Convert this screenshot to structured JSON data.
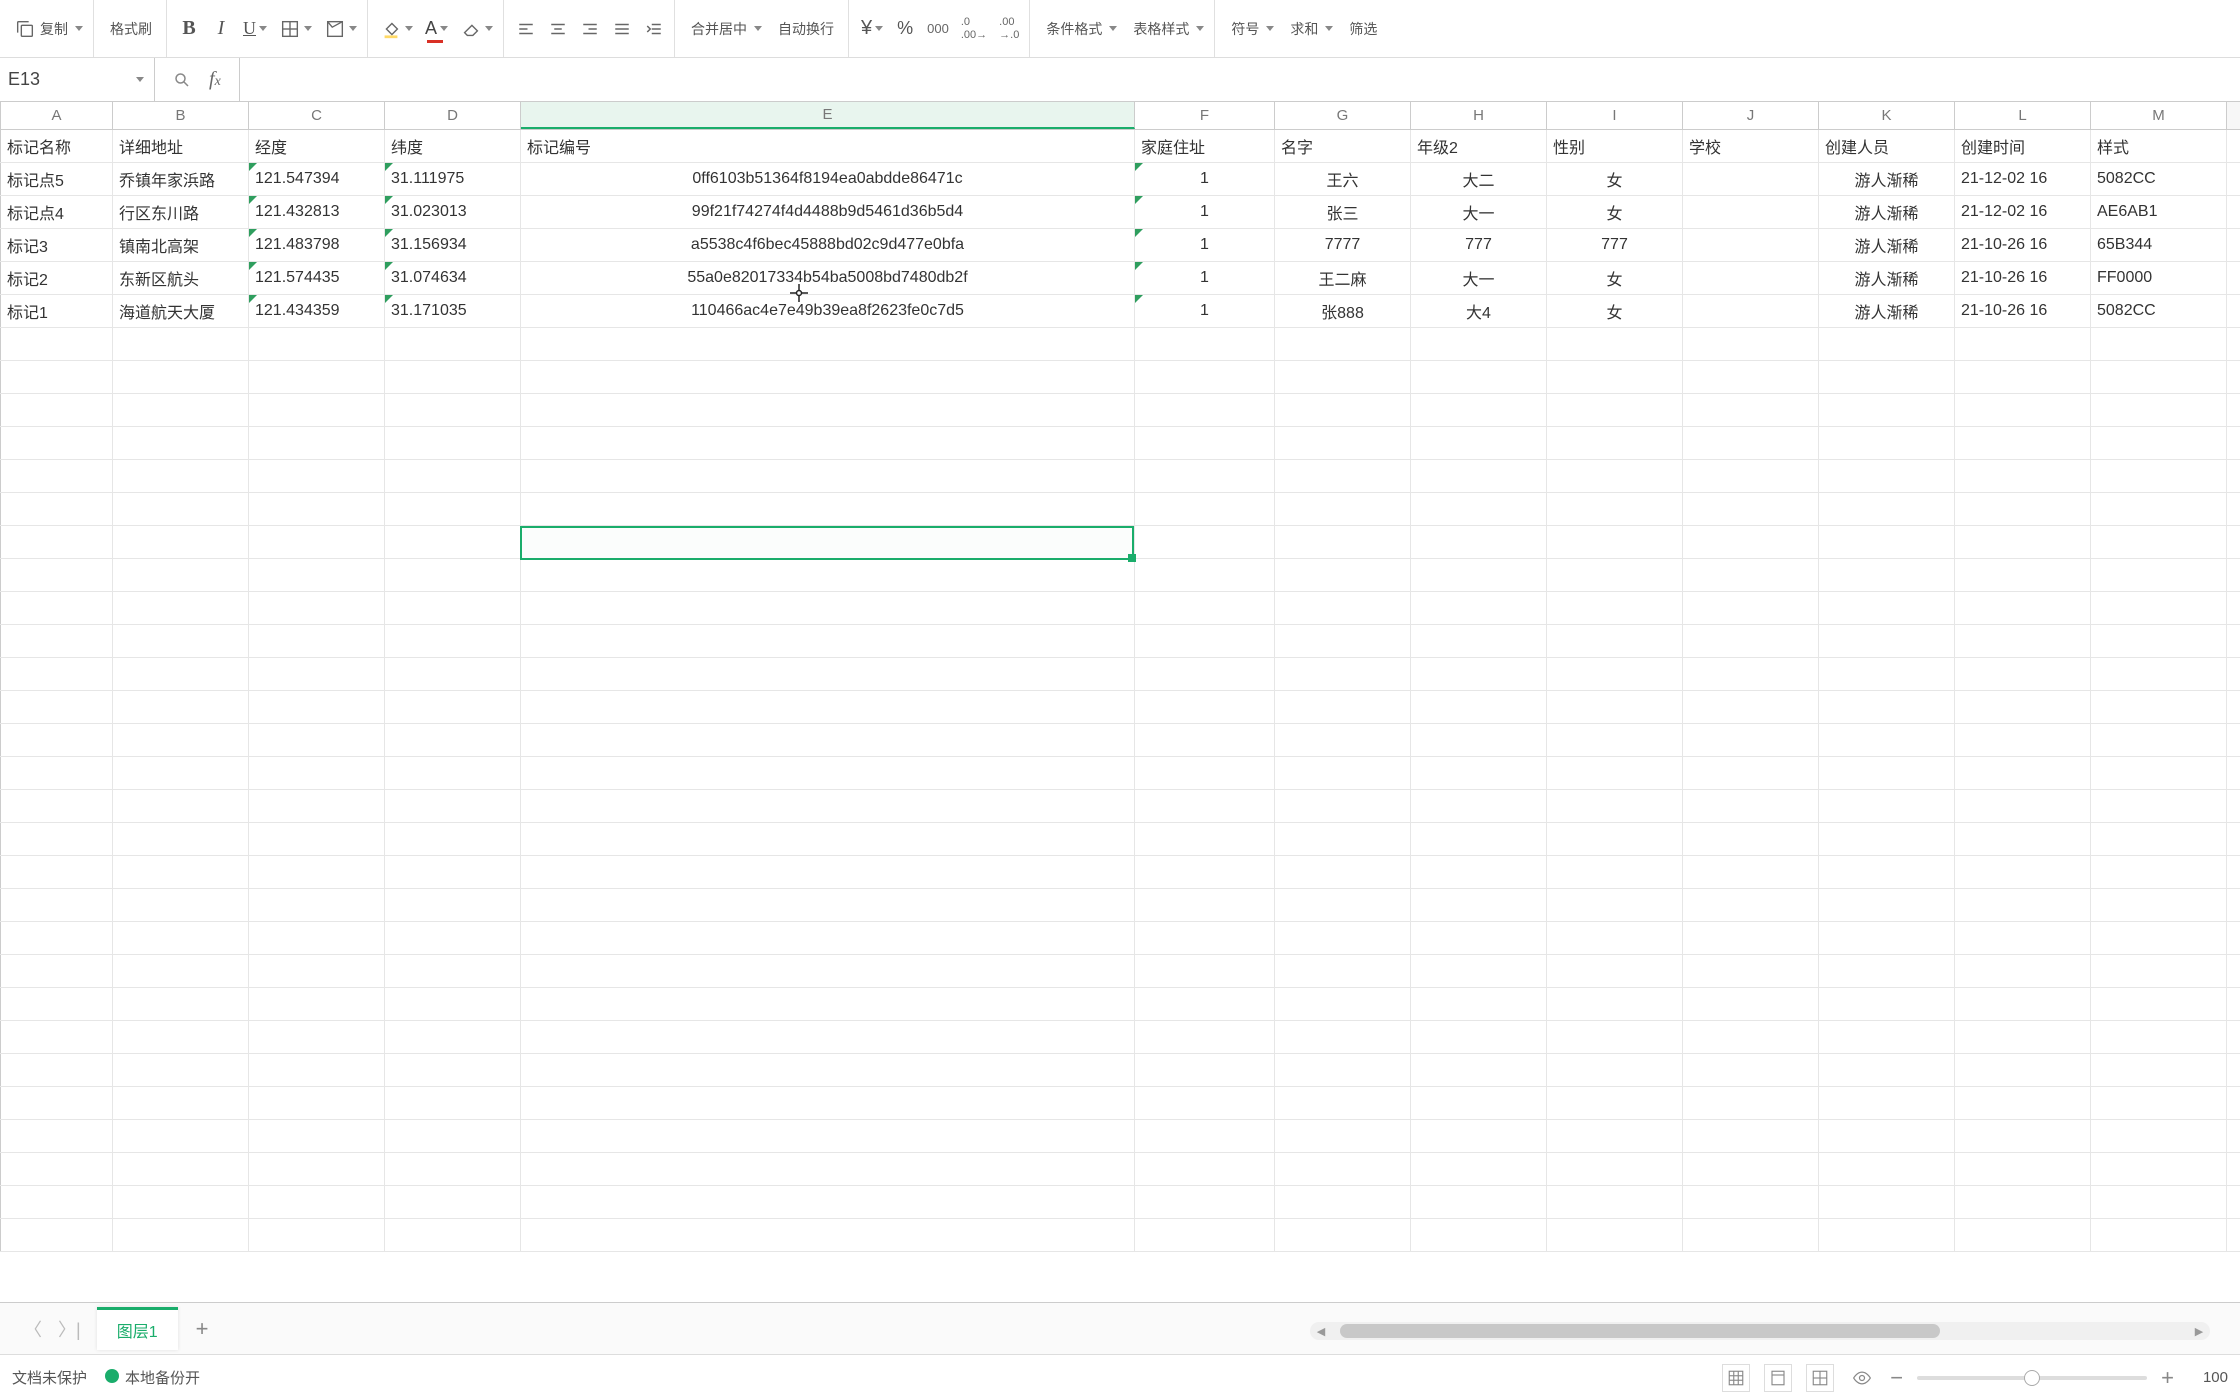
{
  "toolbar": {
    "copy": "复制",
    "format_painter": "格式刷",
    "merge_center": "合并居中",
    "wrap_text": "自动换行",
    "conditional_format": "条件格式",
    "table_style": "表格样式",
    "symbol": "符号",
    "sum": "求和",
    "filter": "筛选",
    "currency": "¥",
    "percent": "%",
    "thousands": "000",
    "inc_dec": ".00",
    "dec_dec": ".00"
  },
  "formula": {
    "cell_ref": "E13",
    "formula_value": ""
  },
  "columns": [
    "A",
    "B",
    "C",
    "D",
    "E",
    "F",
    "G",
    "H",
    "I",
    "J",
    "K",
    "L",
    "M"
  ],
  "headers": {
    "A": "标记名称",
    "B": "详细地址",
    "C": "经度",
    "D": "纬度",
    "E": "标记编号",
    "F": "家庭住址",
    "G": "名字",
    "H": "年级2",
    "I": "性别",
    "J": "学校",
    "K": "创建人员",
    "L": "创建时间",
    "M": "样式"
  },
  "rows": [
    {
      "A": "标记点5",
      "B": "乔镇年家浜路",
      "C": "121.547394",
      "D": "31.111975",
      "E": "0ff6103b51364f8194ea0abdde86471c",
      "F": "1",
      "G": "王六",
      "H": "大二",
      "I": "女",
      "J": "",
      "K": "游人渐稀",
      "L": "21-12-02 16",
      "M": "5082CC"
    },
    {
      "A": "标记点4",
      "B": "行区东川路",
      "C": "121.432813",
      "D": "31.023013",
      "E": "99f21f74274f4d4488b9d5461d36b5d4",
      "F": "1",
      "G": "张三",
      "H": "大一",
      "I": "女",
      "J": "",
      "K": "游人渐稀",
      "L": "21-12-02 16",
      "M": "AE6AB1"
    },
    {
      "A": "标记3",
      "B": "镇南北高架",
      "C": "121.483798",
      "D": "31.156934",
      "E": "a5538c4f6bec45888bd02c9d477e0bfa",
      "F": "1",
      "G": "7777",
      "H": "777",
      "I": "777",
      "J": "",
      "K": "游人渐稀",
      "L": "21-10-26 16",
      "M": "65B344"
    },
    {
      "A": "标记2",
      "B": "东新区航头",
      "C": "121.574435",
      "D": "31.074634",
      "E": "55a0e82017334b54ba5008bd7480db2f",
      "F": "1",
      "G": "王二麻",
      "H": "大一",
      "I": "女",
      "J": "",
      "K": "游人渐稀",
      "L": "21-10-26 16",
      "M": "FF0000"
    },
    {
      "A": "标记1",
      "B": "海道航天大厦",
      "C": "121.434359",
      "D": "31.171035",
      "E": "110466ac4e7e49b39ea8f2623fe0c7d5",
      "F": "1",
      "G": "张888",
      "H": "大4",
      "I": "女",
      "J": "",
      "K": "游人渐稀",
      "L": "21-10-26 16",
      "M": "5082CC"
    }
  ],
  "sheet": {
    "active": "图层1"
  },
  "status": {
    "protect": "文档未保护",
    "backup": "本地备份开",
    "zoom": "100"
  },
  "selection": {
    "col": "E",
    "row": 13
  }
}
